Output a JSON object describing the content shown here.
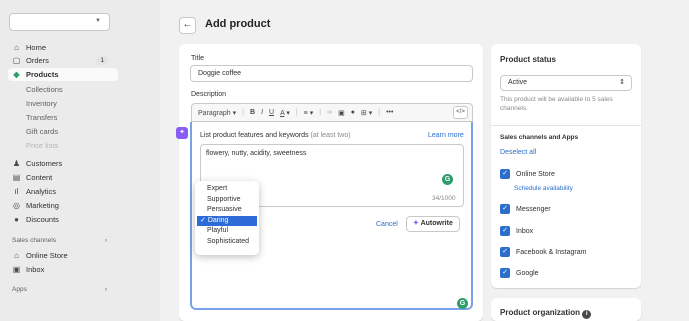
{
  "sidebar": {
    "store_select_value": "",
    "nav": [
      {
        "label": "Home",
        "icon": "home-icon",
        "glyph": "⌂"
      },
      {
        "label": "Orders",
        "icon": "orders-icon",
        "glyph": "▢",
        "badge": "1"
      },
      {
        "label": "Products",
        "icon": "tag-icon",
        "glyph": "◆"
      },
      {
        "label": "Collections"
      },
      {
        "label": "Inventory"
      },
      {
        "label": "Transfers"
      },
      {
        "label": "Gift cards"
      },
      {
        "label": "Price lists"
      },
      {
        "label": "Customers",
        "icon": "person-icon",
        "glyph": "👤"
      },
      {
        "label": "Content",
        "icon": "content-icon",
        "glyph": "▤"
      },
      {
        "label": "Analytics",
        "icon": "analytics-icon",
        "glyph": "ılıl"
      },
      {
        "label": "Marketing",
        "icon": "target-icon",
        "glyph": "◎"
      },
      {
        "label": "Discounts",
        "icon": "discount-icon",
        "glyph": "⊘"
      }
    ],
    "sales_channels_heading": "Sales channels",
    "channels": [
      {
        "label": "Online Store",
        "icon": "store-icon",
        "glyph": "⌂"
      },
      {
        "label": "Inbox",
        "icon": "inbox-icon",
        "glyph": "▣"
      }
    ],
    "apps_heading": "Apps"
  },
  "header": {
    "back_glyph": "←",
    "title": "Add product"
  },
  "product": {
    "title_label": "Title",
    "title_value": "Doggie coffee",
    "description_label": "Description",
    "toolbar": {
      "paragraph": "Paragraph",
      "bold": "B",
      "italic": "I",
      "underline": "U",
      "color": "A",
      "align": "≡",
      "more": "•••",
      "code": "</>"
    }
  },
  "ai": {
    "prompt_label": "List product features and keywords",
    "prompt_hint": "(at least two)",
    "learn_more": "Learn more",
    "keywords": "flowery, nutty, acidity, sweetness",
    "counter": "34/1000",
    "cancel": "Cancel",
    "autowrite": "Autowrite",
    "tone_options": [
      "Expert",
      "Supportive",
      "Persuasive",
      "Daring",
      "Playful",
      "Sophisticated"
    ],
    "selected_tone": "Daring",
    "check": "✓"
  },
  "status": {
    "heading": "Product status",
    "value": "Active",
    "help": "This product will be available to 5 sales channels.",
    "channels_heading": "Sales channels and Apps",
    "deselect": "Deselect all",
    "channels": [
      "Online Store",
      "Messenger",
      "Inbox",
      "Facebook & Instagram",
      "Google"
    ],
    "schedule": "Schedule availability"
  },
  "organization": {
    "heading": "Product organization",
    "info_glyph": "i"
  },
  "colors": {
    "accent": "#2c6ecb",
    "ai_purple": "#8a5cf6",
    "focus": "#7aa2e8",
    "green": "#2e9d6b"
  }
}
